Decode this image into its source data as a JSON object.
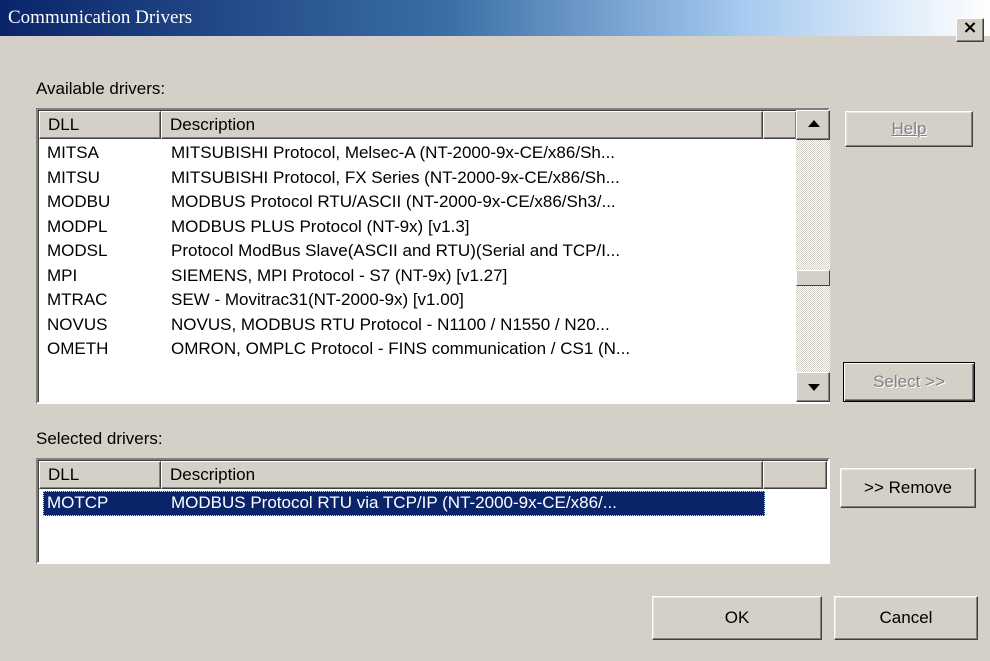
{
  "window": {
    "title": "Communication Drivers",
    "close_glyph": "×"
  },
  "available": {
    "label": "Available drivers:",
    "columns": [
      "DLL",
      "Description"
    ],
    "rows": [
      {
        "dll": "MITSA",
        "desc": "MITSUBISHI Protocol, Melsec-A  (NT-2000-9x-CE/x86/Sh..."
      },
      {
        "dll": "MITSU",
        "desc": "MITSUBISHI Protocol, FX Series  (NT-2000-9x-CE/x86/Sh..."
      },
      {
        "dll": "MODBU",
        "desc": "MODBUS Protocol RTU/ASCII (NT-2000-9x-CE/x86/Sh3/..."
      },
      {
        "dll": "MODPL",
        "desc": "MODBUS PLUS Protocol (NT-9x) [v1.3]"
      },
      {
        "dll": "MODSL",
        "desc": "Protocol ModBus Slave(ASCII and RTU)(Serial and TCP/I..."
      },
      {
        "dll": "MPI",
        "desc": "SIEMENS, MPI Protocol - S7 (NT-9x) [v1.27]"
      },
      {
        "dll": "MTRAC",
        "desc": "SEW - Movitrac31(NT-2000-9x) [v1.00]"
      },
      {
        "dll": "NOVUS",
        "desc": "NOVUS, MODBUS RTU Protocol - N1100 / N1550 / N20..."
      },
      {
        "dll": "OMETH",
        "desc": "OMRON, OMPLC Protocol - FINS communication / CS1 (N..."
      }
    ]
  },
  "selected": {
    "label": "Selected drivers:",
    "columns": [
      "DLL",
      "Description"
    ],
    "rows": [
      {
        "dll": "MOTCP",
        "desc": "MODBUS Protocol RTU via TCP/IP (NT-2000-9x-CE/x86/..."
      }
    ]
  },
  "buttons": {
    "help": "Help",
    "select": "Select >>",
    "remove": ">> Remove",
    "ok": "OK",
    "cancel": "Cancel"
  },
  "scrollbar": {
    "position": 0.6
  },
  "colors": {
    "face": "#d4d0c8",
    "title_start": "#0a246a",
    "title_end": "#a6caf0",
    "selection": "#0a246a"
  }
}
